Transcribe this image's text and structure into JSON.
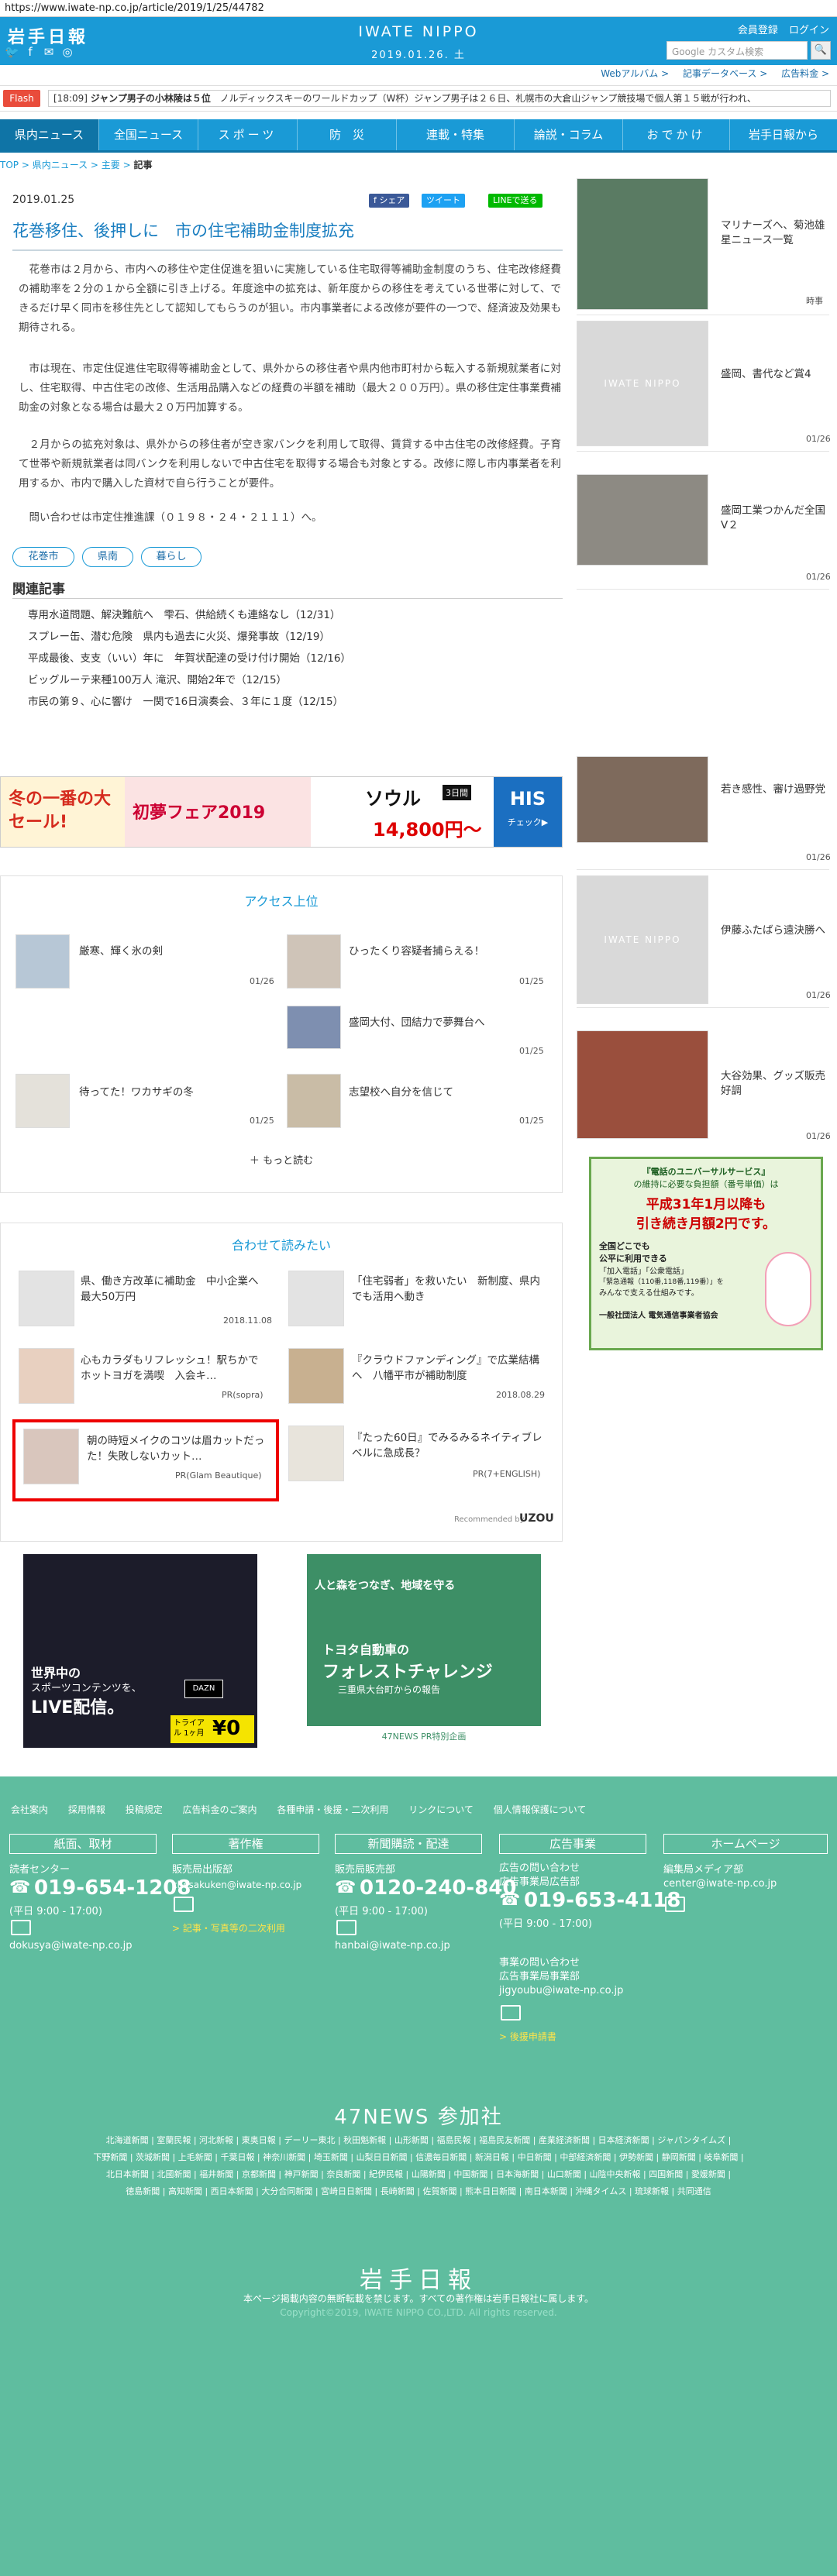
{
  "browser": {
    "url": "https://www.iwate-np.co.jp/article/2019/1/25/44782"
  },
  "header": {
    "logo_left": "岩手日報",
    "center_logo": "IWATE NIPPO",
    "center_date": "2019.01.26. 土",
    "member_links": [
      "会員登録",
      "ログイン"
    ],
    "search_placeholder": "Google カスタム検索",
    "search_icon": "search-icon",
    "social_icons": [
      "twitter-icon",
      "facebook-icon",
      "line-icon",
      "instagram-icon"
    ],
    "sub_links": [
      "Webアルバム >",
      "記事データベース >",
      "広告料金 >"
    ]
  },
  "flash": {
    "label": "Flash",
    "time": "[18:09]",
    "headline": "ジャンプ男子の小林陵は５位",
    "ticker": "ノルディックスキーのワールドカップ（W杯）ジャンプ男子は２６日、札幌市の大倉山ジャンプ競技場で個人第１５戦が行われ、"
  },
  "nav": {
    "items": [
      "県内ニュース",
      "全国ニュース",
      "スポーツ",
      "防　災",
      "連載・特集",
      "論説・コラム",
      "おでかけ",
      "岩手日報から"
    ]
  },
  "breadcrumb": {
    "items": [
      "TOP",
      "県内ニュース",
      "主要"
    ],
    "current": "記事"
  },
  "article": {
    "date": "2019.01.25",
    "share": {
      "facebook": "f シェア",
      "twitter": "ツイート",
      "line": "LINEで送る"
    },
    "title": "花巻移住、後押しに　市の住宅補助金制度拡充",
    "paragraphs": [
      "花巻市は２月から、市内への移住や定住促進を狙いに実施している住宅取得等補助金制度のうち、住宅改修経費の補助率を２分の１から全額に引き上げる。年度途中の拡充は、新年度からの移住を考えている世帯に対して、できるだけ早く同市を移住先として認知してもらうのが狙い。市内事業者による改修が要件の一つで、経済波及効果も期待される。",
      "市は現在、市定住促進住宅取得等補助金として、県外からの移住者や県内他市町村から転入する新規就業者に対し、住宅取得、中古住宅の改修、生活用品購入などの経費の半額を補助（最大２００万円）。県の移住定住事業費補助金の対象となる場合は最大２０万円加算する。",
      "２月からの拡充対象は、県外からの移住者が空き家バンクを利用して取得、賃貸する中古住宅の改修経費。子育て世帯や新規就業者は同バンクを利用しないで中古住宅を取得する場合も対象とする。改修に際し市内事業者を利用するか、市内で購入した資材で自ら行うことが要件。",
      "問い合わせは市定住推進課（０１９８・２４・２１１１）へ。"
    ],
    "tags": [
      "花巻市",
      "県南",
      "暮らし"
    ],
    "related_heading": "関連記事",
    "related": [
      "専用水道問題、解決難航へ　雫石、供給続くも連絡なし（12/31）",
      "スプレー缶、潜む危険　県内も過去に火災、爆発事故（12/19）",
      "平成最後、支支（いい）年に　年賀状配達の受け付け開始（12/16）",
      "ビッグルーテ来種100万人 滝沢、開始2年で（12/15）",
      "市民の第９、心に響け　一関で16日演奏会、３年に１度（12/15）"
    ]
  },
  "travel_banner": {
    "left_text": "冬の一番の大セール!",
    "mid_text": "初夢フェア2019",
    "seoul": "ソウル",
    "days": "3日間",
    "price": "14,800円〜",
    "brand": "HIS",
    "check": "チェック▶"
  },
  "ranking": {
    "heading": "アクセス上位",
    "items": [
      {
        "title": "厳寒、輝く氷の剣",
        "date": "01/26"
      },
      {
        "title": "ひったくり容疑者捕らえる！",
        "date": "01/25"
      },
      {
        "title": "盛岡大付、団結力で夢舞台へ",
        "date": "01/25"
      },
      {
        "title": "待ってた！ワカサギの冬",
        "date": "01/25"
      },
      {
        "title": "志望校へ自分を信じて",
        "date": "01/25"
      }
    ],
    "more": "もっと読む"
  },
  "recommend": {
    "heading": "合わせて読みたい",
    "items": [
      {
        "title": "県、働き方改革に補助金　中小企業へ最大50万円",
        "date": "2018.11.08"
      },
      {
        "title": "「住宅弱者」を救いたい　新制度、県内でも活用へ動き",
        "date": ""
      },
      {
        "title": "心もカラダもリフレッシュ！駅ちかでホットヨガを満喫　入会キ…",
        "date": "PR(sopra)"
      },
      {
        "title": "『クラウドファンディング』で広業結構へ　八幡平市が補助制度",
        "date": "2018.08.29"
      },
      {
        "title": "朝の時短メイクのコツは眉カットだった！失敗しないカット…",
        "date": "PR(Glam Beautique)"
      },
      {
        "title": "『たった60日』でみるみるネイティブレベルに急成長？",
        "date": "PR(7+ENGLISH)"
      }
    ],
    "recommended_by": "Recommended by",
    "uzou": "UZOU"
  },
  "bottom_ads": {
    "left": {
      "line1": "世界中の",
      "line2": "スポーツコンテンツを、",
      "line3": "LIVE配信。",
      "dazn": "DAZN",
      "trial": "トライアル 1ヶ月",
      "yen": "¥0"
    },
    "right": {
      "line1": "人と森をつなぎ、地域を守る",
      "line2": "トヨタ自動車の",
      "line3": "フォレストチャレンジ",
      "line4": "三重県大台町からの報告",
      "line5": "47NEWS PR特別企画"
    }
  },
  "sidebar": {
    "items": [
      {
        "title": "マリナーズへ、菊池雄星ニュース一覧",
        "date": "",
        "credit": "時事"
      },
      {
        "title": "盛岡、書代など賞4",
        "date": "01/26"
      },
      {
        "title": "盛岡工業つかんだ全国V２",
        "date": "01/26"
      },
      {
        "title": "若き感性、審け過野党",
        "date": "01/26"
      },
      {
        "title": "伊藤ふたばら遠決勝へ",
        "date": "01/26"
      },
      {
        "title": "大谷効果、グッズ販売好調",
        "date": "01/26"
      }
    ],
    "placeholder_text": "IWATE NIPPO",
    "ad": {
      "line1": "『電話のユニバーサルサービス』",
      "line2": "の維持に必要な負担額（番号単価）は",
      "line3": "平成31年1月以降も",
      "line4": "引き続き月額2円です。",
      "line5": "全国どこでも",
      "line6": "公平に利用できる",
      "line7": "「加入電話」「公衆電話」",
      "line8": "「緊急通報（110番,118番,119番）」を",
      "line9": "みんなで支える仕組みです。",
      "line10": "一般社団法人 電気通信事業者協会"
    }
  },
  "footer": {
    "links": [
      "会社案内",
      "採用情報",
      "投稿規定",
      "広告料金のご案内",
      "各種申請・後援・二次利用",
      "リンクについて",
      "個人情報保護について"
    ],
    "cols": [
      {
        "heading": "紙面、取材",
        "sub": "読者センター",
        "phone": "019-654-1208",
        "hours": "(平日 9:00 - 17:00)",
        "email": "dokusya@iwate-np.co.jp"
      },
      {
        "heading": "著作権",
        "sub": "販売局出版部",
        "email": "chosakuken@iwate-np.co.jp",
        "link": "> 記事・写真等の二次利用"
      },
      {
        "heading": "新聞購読・配達",
        "sub": "販売局販売部",
        "phone": "0120-240-840",
        "hours": "(平日 9:00 - 17:00)",
        "email": "hanbai@iwate-np.co.jp"
      },
      {
        "heading": "広告事業",
        "sub": "広告の問い合わせ",
        "sub2": "広告事業局広告部",
        "phone": "019-653-4118",
        "hours": "(平日 9:00 - 17:00)",
        "sub3": "事業の問い合わせ",
        "sub4": "広告事業局事業部",
        "email": "jigyoubu@iwate-np.co.jp",
        "link": "> 後援申請書"
      },
      {
        "heading": "ホームページ",
        "sub": "編集局メディア部",
        "email": "center@iwate-np.co.jp"
      }
    ],
    "n47_heading": "47NEWS 参加社",
    "n47_rows": [
      "北海道新聞 | 室蘭民報 | 河北新報 | 東奥日報 | デーリー東北 | 秋田魁新報 | 山形新聞 | 福島民報 | 福島民友新聞 | 産業経済新聞 | 日本経済新聞 | ジャパンタイムズ |",
      "下野新聞 | 茨城新聞 | 上毛新聞 | 千葉日報 | 神奈川新聞 | 埼玉新聞 | 山梨日日新聞 | 信濃毎日新聞 | 新潟日報 | 中日新聞 | 中部経済新聞 | 伊勢新聞 | 静岡新聞 | 岐阜新聞 |",
      "北日本新聞 | 北國新聞 | 福井新聞 | 京都新聞 | 神戸新聞 | 奈良新聞 | 紀伊民報 | 山陽新聞 | 中国新聞 | 日本海新聞 | 山口新聞 | 山陰中央新報 | 四国新聞 | 愛媛新聞 |",
      "徳島新聞 | 高知新聞 | 西日本新聞 | 大分合同新聞 | 宮崎日日新聞 | 長崎新聞 | 佐賀新聞 | 熊本日日新聞 | 南日本新聞 | 沖縄タイムス | 琉球新報 | 共同通信"
    ],
    "logo": "岩手日報",
    "note": "本ページ掲載内容の無断転載を禁じます。すべての著作権は岩手日報社に属します。",
    "copyright": "Copyright©2019, IWATE NIPPO CO.,LTD. All rights reserved."
  }
}
